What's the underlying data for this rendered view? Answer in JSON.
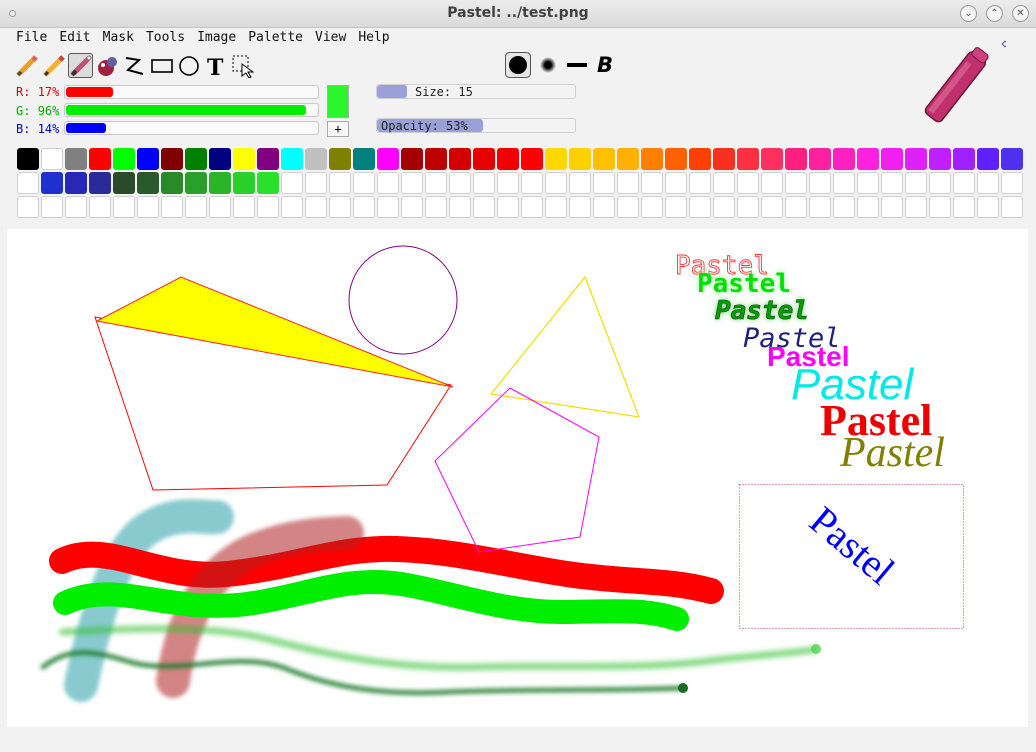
{
  "window": {
    "title": "Pastel: ../test.png",
    "buttons": {
      "minimize": "⌄",
      "maximize": "⌃",
      "close": "✕"
    }
  },
  "menu": [
    "File",
    "Edit",
    "Mask",
    "Tools",
    "Image",
    "Palette",
    "View",
    "Help"
  ],
  "tools": [
    {
      "name": "pencil-tool-icon",
      "selected": false
    },
    {
      "name": "pencil-orange-tool-icon",
      "selected": false
    },
    {
      "name": "brush-tool-icon",
      "selected": true
    },
    {
      "name": "spray-tool-icon",
      "selected": false
    },
    {
      "name": "polyline-tool-icon",
      "selected": false
    },
    {
      "name": "rectangle-tool-icon",
      "selected": false
    },
    {
      "name": "ellipse-tool-icon",
      "selected": false
    },
    {
      "name": "text-tool-icon",
      "selected": false
    },
    {
      "name": "select-tool-icon",
      "selected": false
    }
  ],
  "brush_shapes": [
    "round-hard",
    "round-soft",
    "flat",
    "bold"
  ],
  "brush_bold_label": "B",
  "color": {
    "r": {
      "label": "R:",
      "value": "17%",
      "fraction": 0.17,
      "color": "#ff0000",
      "text_color": "#e00000"
    },
    "g": {
      "label": "G:",
      "value": "96%",
      "fraction": 0.96,
      "color": "#00ee00",
      "text_color": "#00b000"
    },
    "b": {
      "label": "B:",
      "value": "14%",
      "fraction": 0.14,
      "color": "#0000ff",
      "text_color": "#0000cc"
    },
    "current": "#2bf52b",
    "add_label": "+"
  },
  "size": {
    "label": "Size:",
    "value": "15",
    "fraction": 0.15
  },
  "opacity": {
    "label": "Opacity:",
    "value": "53%",
    "fraction": 0.53
  },
  "palette_colors": [
    "#000000",
    "#ffffff",
    "#808080",
    "#ff0000",
    "#00ff00",
    "#0000ff",
    "#800000",
    "#008000",
    "#000080",
    "#ffff00",
    "#800080",
    "#00ffff",
    "#c0c0c0",
    "#808000",
    "#008080",
    "#ff00ff",
    "#a50000",
    "#bf0000",
    "#d40000",
    "#e60000",
    "#f00000",
    "#ff0000",
    "#ffd800",
    "#ffd000",
    "#ffc000",
    "#ffb000",
    "#ff8000",
    "#ff6000",
    "#ff4000",
    "#f83020",
    "#ff3040",
    "#ff3060",
    "#ff2080",
    "#ff20a0",
    "#ff20c0",
    "#ff20e0",
    "#f020f0",
    "#e020f8",
    "#c020ff",
    "#a020ff",
    "#6020ff",
    "#5030f0",
    null,
    "#2030d0",
    "#2828b8",
    "#2a2a98",
    "#2a4a2a",
    "#2a5a2a",
    "#2a8a2a",
    "#2aa02a",
    "#2ab42a",
    "#2ad02a",
    "#2ae02a"
  ],
  "palette_total_cells": 126,
  "canvas": {
    "texts": [
      "Pastel",
      "Pastel",
      "Pastel",
      "Pastel",
      "Pastel",
      "Pastel",
      "Pastel",
      "Pastel",
      "Pastel"
    ]
  }
}
